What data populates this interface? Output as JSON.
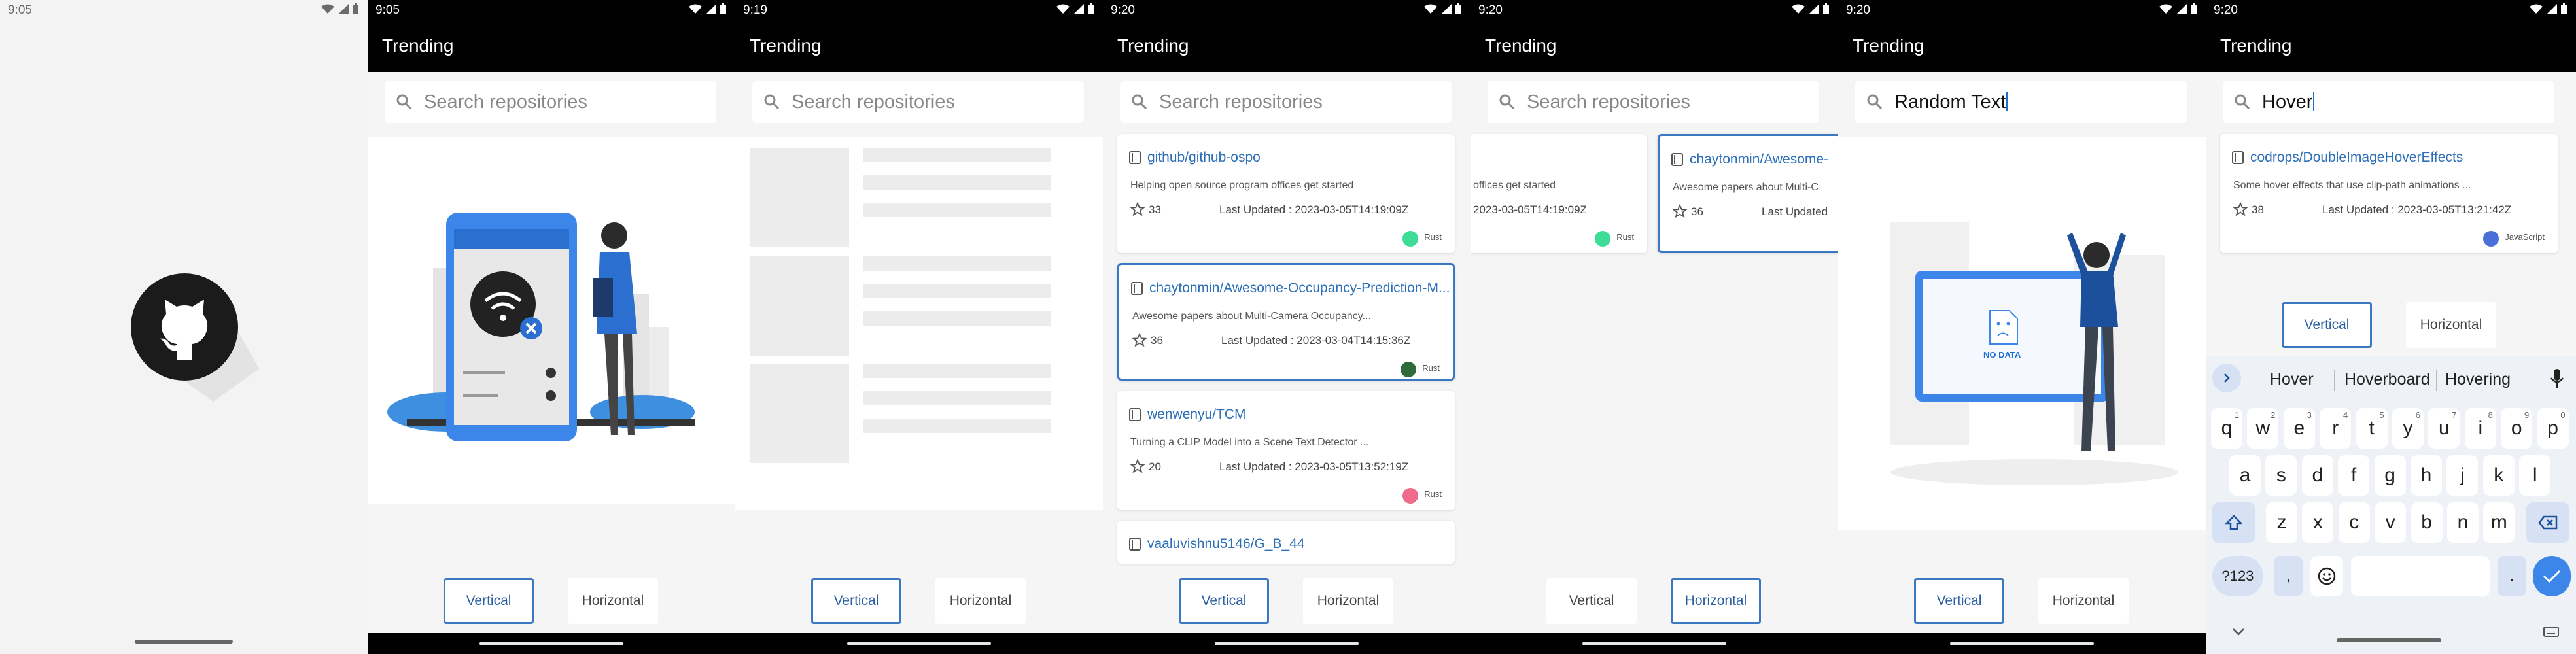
{
  "splash": {
    "time": "9:05"
  },
  "app": {
    "title": "Trending"
  },
  "search": {
    "placeholder": "Search repositories"
  },
  "toggles": {
    "vertical": "Vertical",
    "horizontal": "Horizontal"
  },
  "screens": [
    {
      "time": "9:05"
    },
    {
      "time": "9:19"
    },
    {
      "time": "9:20"
    },
    {
      "time": "9:20"
    },
    {
      "time": "9:20",
      "query": "Random Text",
      "empty_label": "NO DATA"
    },
    {
      "time": "9:20",
      "query": "Hover"
    }
  ],
  "repos": [
    {
      "name": "github/github-ospo",
      "desc": "Helping open source program offices get started",
      "stars": "33",
      "updated": "Last Updated : 2023-03-05T14:19:09Z",
      "lang": "Rust",
      "color": "#3ddc97"
    },
    {
      "name": "chaytonmin/Awesome-Occupancy-Prediction-M...",
      "desc": "Awesome papers about Multi-Camera Occupancy...",
      "stars": "36",
      "updated": "Last Updated : 2023-03-04T14:15:36Z",
      "lang": "Rust",
      "color": "#2f6b3a"
    },
    {
      "name": "wenwenyu/TCM",
      "desc": "Turning a CLIP Model into a Scene Text Detector ...",
      "stars": "20",
      "updated": "Last Updated : 2023-03-05T13:52:19Z",
      "lang": "Rust",
      "color": "#f06b8b"
    },
    {
      "name": "vaaluvishnu5146/G_B_44"
    }
  ],
  "horizontal_view": {
    "partial_desc": "offices get started",
    "partial_updated": "2023-03-05T14:19:09Z",
    "partial_lang": "Rust",
    "card2_name": "chaytonmin/Awesome-",
    "card2_desc": "Awesome papers about Multi-C",
    "card2_stars": "36",
    "card2_updated": "Last Updated"
  },
  "hover_result": {
    "name": "codrops/DoubleImageHoverEffects",
    "desc": "Some hover effects that use clip-path animations ...",
    "stars": "38",
    "updated": "Last Updated : 2023-03-05T13:21:42Z",
    "lang": "JavaScript",
    "color": "#4a6fd8"
  },
  "keyboard": {
    "suggestions": [
      "Hover",
      "Hoverboard",
      "Hovering"
    ],
    "row1": [
      "q",
      "w",
      "e",
      "r",
      "t",
      "y",
      "u",
      "i",
      "o",
      "p"
    ],
    "hints": [
      "1",
      "2",
      "3",
      "4",
      "5",
      "6",
      "7",
      "8",
      "9",
      "0"
    ],
    "row2": [
      "a",
      "s",
      "d",
      "f",
      "g",
      "h",
      "j",
      "k",
      "l"
    ],
    "row3": [
      "z",
      "x",
      "c",
      "v",
      "b",
      "n",
      "m"
    ],
    "symbols_key": "?123",
    "comma": ",",
    "period": "."
  },
  "colors": {
    "accent": "#3a78c4",
    "link": "#2d6fb8",
    "appbar": "#000000"
  }
}
